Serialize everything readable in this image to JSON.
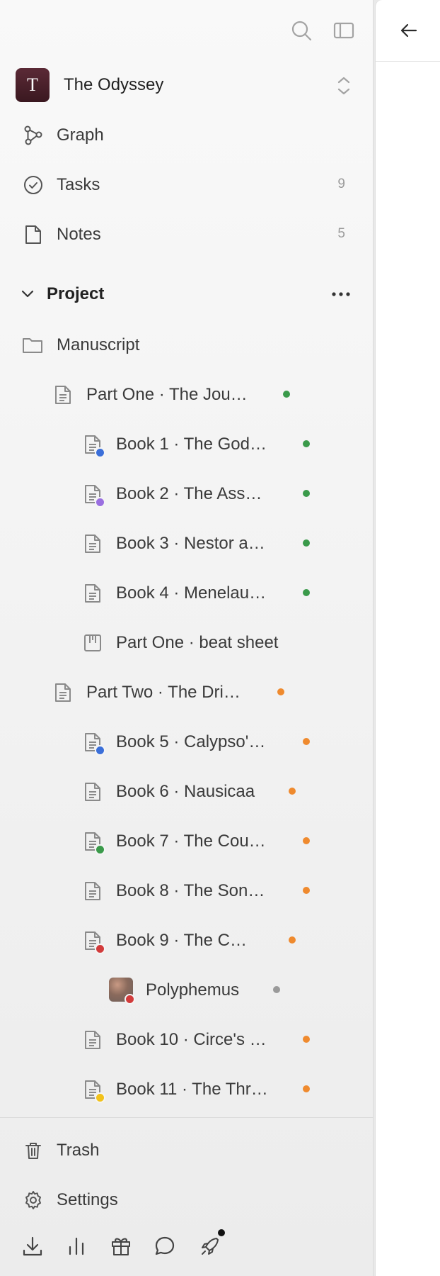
{
  "workspace": {
    "initial": "T",
    "name": "The Odyssey"
  },
  "nav": {
    "graph": {
      "label": "Graph"
    },
    "tasks": {
      "label": "Tasks",
      "count": "9"
    },
    "notes": {
      "label": "Notes",
      "count": "5"
    }
  },
  "section": {
    "title": "Project"
  },
  "tree": {
    "manuscript": "Manuscript",
    "items": [
      {
        "label": "Part One · The Jou…",
        "status_color": "#3a9a4a"
      },
      {
        "label": "Book 1 · The God…",
        "status_color": "#3a9a4a",
        "badge_color": "#3b6fd9"
      },
      {
        "label": "Book 2 · The Ass…",
        "status_color": "#3a9a4a",
        "badge_color": "#9a6fe0"
      },
      {
        "label": "Book 3 · Nestor a…",
        "status_color": "#3a9a4a"
      },
      {
        "label": "Book 4 · Menelau…",
        "status_color": "#3a9a4a"
      },
      {
        "label": "Part One · beat sheet"
      },
      {
        "label": "Part Two · The Dri…",
        "status_color": "#ef8a2e"
      },
      {
        "label": "Book 5 · Calypso'…",
        "status_color": "#ef8a2e",
        "badge_color": "#3b6fd9"
      },
      {
        "label": "Book 6 · Nausicaa",
        "status_color": "#ef8a2e"
      },
      {
        "label": "Book 7 · The Cou…",
        "status_color": "#ef8a2e",
        "badge_color": "#3a9a4a"
      },
      {
        "label": "Book 8 · The Son…",
        "status_color": "#ef8a2e"
      },
      {
        "label": "Book 9 · The C…",
        "status_color": "#ef8a2e",
        "badge_color": "#d23b3b"
      },
      {
        "label": "Polyphemus",
        "status_color": "#9a9a9a",
        "badge_color": "#d23b3b"
      },
      {
        "label": "Book 10 · Circe's …",
        "status_color": "#ef8a2e"
      },
      {
        "label": "Book 11 · The Thr…",
        "status_color": "#ef8a2e",
        "badge_color": "#f2c21b"
      }
    ]
  },
  "footer": {
    "trash": "Trash",
    "settings": "Settings"
  },
  "icons": {
    "search": "search-icon",
    "sidebar_toggle": "sidebar-toggle-icon",
    "back": "arrow-left-icon",
    "graph": "graph-icon",
    "tasks": "check-circle-icon",
    "notes": "note-icon",
    "folder": "folder-icon",
    "doc": "document-icon",
    "beat_sheet": "beat-sheet-icon",
    "trash": "trash-icon",
    "settings": "gear-icon",
    "download": "download-icon",
    "stats": "bar-chart-icon",
    "gift": "gift-icon",
    "chat": "chat-icon",
    "launch": "rocket-icon"
  }
}
